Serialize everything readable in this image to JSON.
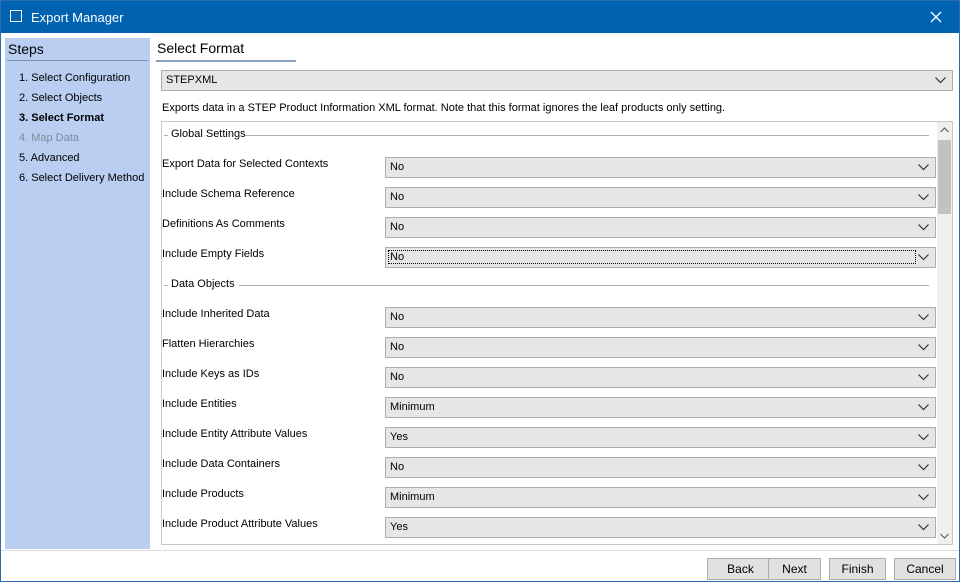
{
  "window": {
    "title": "Export Manager"
  },
  "sidebar": {
    "title": "Steps",
    "steps": [
      {
        "label": "1. Select Configuration",
        "state": "normal"
      },
      {
        "label": "2. Select Objects",
        "state": "normal"
      },
      {
        "label": "3. Select Format",
        "state": "active"
      },
      {
        "label": "4. Map Data",
        "state": "disabled"
      },
      {
        "label": "5. Advanced",
        "state": "normal"
      },
      {
        "label": "6. Select Delivery Method",
        "state": "normal"
      }
    ]
  },
  "main": {
    "title": "Select Format",
    "format_value": "STEPXML",
    "description": "Exports data in a STEP Product Information XML format. Note that this format ignores the leaf products only setting.",
    "groups": {
      "global": "Global Settings",
      "data_objects": "Data Objects"
    },
    "settings": [
      {
        "label": "Export Data for Selected Contexts",
        "value": "No"
      },
      {
        "label": "Include Schema Reference",
        "value": "No"
      },
      {
        "label": "Definitions As Comments",
        "value": "No"
      },
      {
        "label": "Include Empty Fields",
        "value": "No"
      },
      {
        "label": "Include Inherited Data",
        "value": "No"
      },
      {
        "label": "Flatten Hierarchies",
        "value": "No"
      },
      {
        "label": "Include Keys as IDs",
        "value": "No"
      },
      {
        "label": "Include Entities",
        "value": "Minimum"
      },
      {
        "label": "Include Entity Attribute Values",
        "value": "Yes"
      },
      {
        "label": "Include Data Containers",
        "value": "No"
      },
      {
        "label": "Include Products",
        "value": "Minimum"
      },
      {
        "label": "Include Product Attribute Values",
        "value": "Yes"
      }
    ]
  },
  "footer": {
    "back": "Back",
    "next": "Next",
    "finish": "Finish",
    "cancel": "Cancel"
  },
  "colors": {
    "titlebar": "#0063b1",
    "sidebar": "#b9cef0"
  }
}
